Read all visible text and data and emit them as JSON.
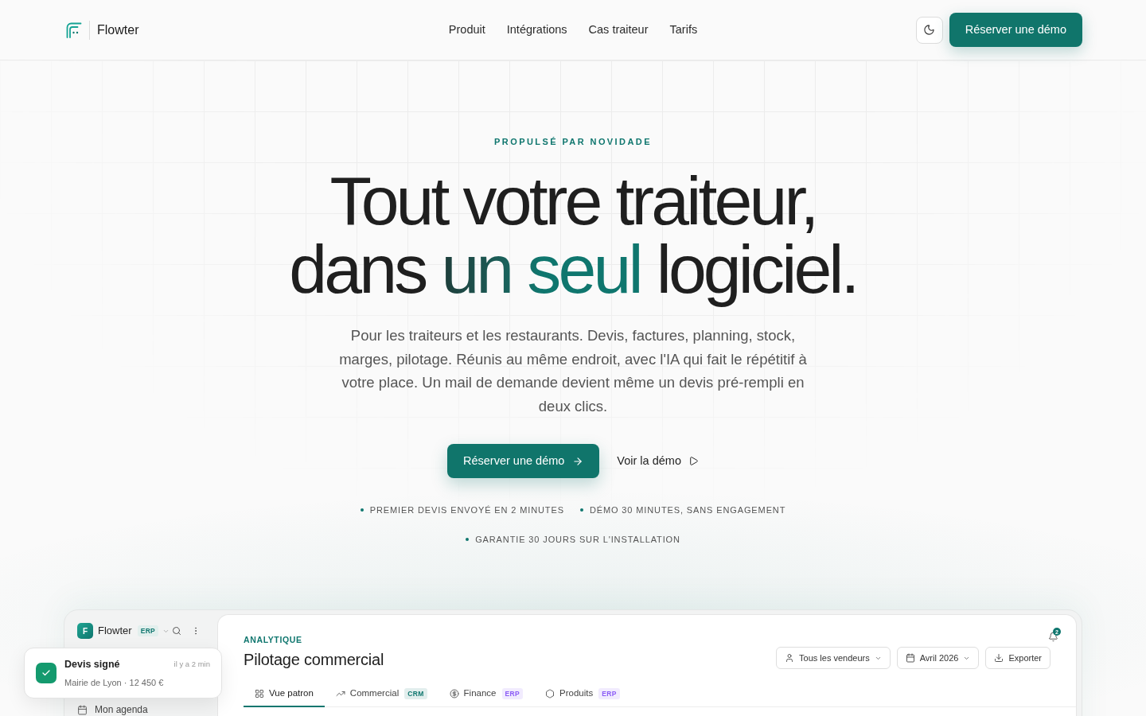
{
  "header": {
    "brand": "Flowter",
    "nav": [
      {
        "label": "Produit"
      },
      {
        "label": "Intégrations"
      },
      {
        "label": "Cas traiteur"
      },
      {
        "label": "Tarifs"
      }
    ],
    "cta": "Réserver une démo"
  },
  "hero": {
    "eyebrow": "PROPULSÉ PAR NOVIDADE",
    "title": {
      "line_1": "Tout votre traiteur,",
      "line_2": [
        {
          "text": "dans",
          "accent": false
        },
        {
          "text": "un seul",
          "accent": true
        },
        {
          "text": "logiciel.",
          "accent": false
        }
      ]
    },
    "lead": "Pour les traiteurs et les restaurants. Devis, factures, planning, stock, marges, pilotage. Réunis au même endroit, avec l'IA qui fait le répétitif à votre place. Un mail de demande devient même un devis pré-rempli en deux clics.",
    "primary_button": "Réserver une démo",
    "secondary_link": "Voir la démo",
    "highlights": [
      "PREMIER DEVIS ENVOYÉ EN 2 MINUTES",
      "DÉMO 30 MINUTES, SANS ENGAGEMENT",
      "GARANTIE 30 JOURS SUR L'INSTALLATION"
    ]
  },
  "app_preview": {
    "sidebar": {
      "logo_letter": "F",
      "brand": "Flowter",
      "badge": "ERP",
      "items": [
        {
          "label": "Mon agenda"
        }
      ]
    },
    "toast": {
      "title": "Devis signé",
      "time": "il y a 2 min",
      "detail": "Mairie de Lyon · 12 450 €"
    },
    "main": {
      "eyebrow": "ANALYTIQUE",
      "title": "Pilotage commercial",
      "notifications": "2",
      "filters": [
        {
          "label": "Tous les vendeurs",
          "kind": "dropdown"
        },
        {
          "label": "Avril 2026",
          "kind": "dropdown"
        },
        {
          "label": "Exporter",
          "kind": "action"
        }
      ],
      "tabs": [
        {
          "label": "Vue patron",
          "selected": true
        },
        {
          "label": "Commercial",
          "selected": false,
          "badge": {
            "label": "CRM",
            "color": "#0f766e"
          }
        },
        {
          "label": "Finance",
          "selected": false,
          "badge": {
            "label": "ERP",
            "color": "#8b5cf6"
          }
        },
        {
          "label": "Produits",
          "selected": false,
          "badge": {
            "label": "ERP",
            "color": "#8b5cf6"
          }
        }
      ]
    }
  }
}
